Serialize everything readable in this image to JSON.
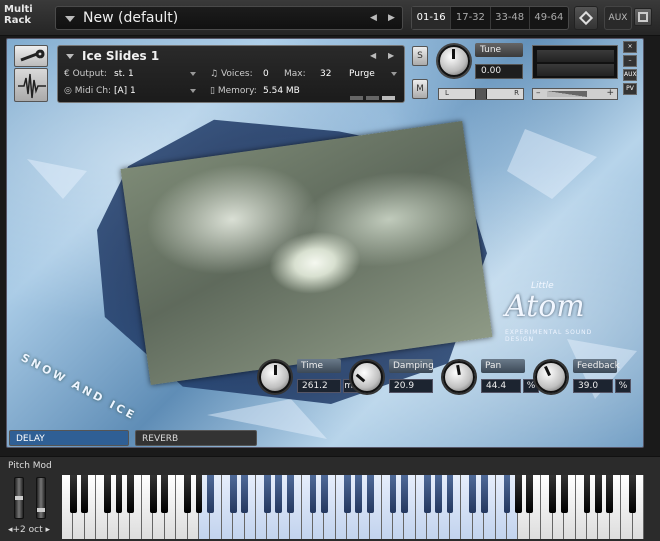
{
  "rack": {
    "label_line1": "Multi",
    "label_line2": "Rack",
    "title": "New (default)",
    "prev_arrow": "◀",
    "next_arrow": "▶",
    "pages": [
      "01-16",
      "17-32",
      "33-48",
      "49-64"
    ],
    "active_page": "01-16",
    "aux_label": "AUX"
  },
  "instrument": {
    "name": "Ice Slides 1",
    "output_label": "Output:",
    "output_value": "st. 1",
    "voices_label": "Voices:",
    "voices_value": "0",
    "max_label": "Max:",
    "max_value": "32",
    "purge_label": "Purge",
    "midi_label": "Midi Ch:",
    "midi_value": "[A]  1",
    "memory_label": "Memory:",
    "memory_value": "5.54 MB",
    "solo_label": "S",
    "mute_label": "M",
    "tune_label": "Tune",
    "tune_value": "0.00",
    "pan_left": "L",
    "pan_right": "R",
    "vol_minus": "–",
    "vol_plus": "+",
    "mini_buttons": [
      "×",
      "–",
      "AUX",
      "PV"
    ]
  },
  "artwork": {
    "snow_label": "SNOW AND ICE",
    "logo_small": "Little",
    "logo_main": "Atom",
    "logo_tag": "EXPERIMENTAL SOUND DESIGN"
  },
  "effects": [
    {
      "label": "Time",
      "value": "261.2",
      "unit": "ms"
    },
    {
      "label": "Damping",
      "value": "20.9",
      "unit": ""
    },
    {
      "label": "Pan",
      "value": "44.4",
      "unit": "%"
    },
    {
      "label": "Feedback",
      "value": "39.0",
      "unit": "%"
    }
  ],
  "tabs": [
    {
      "label": "DELAY",
      "active": true
    },
    {
      "label": "REVERB",
      "active": false
    }
  ],
  "keyboard": {
    "pitch_label": "Pitch Mod",
    "octave_label": "◂+2 oct ▸"
  },
  "colors": {
    "accent": "#2f5f95",
    "ice": "#8fb8dc"
  }
}
